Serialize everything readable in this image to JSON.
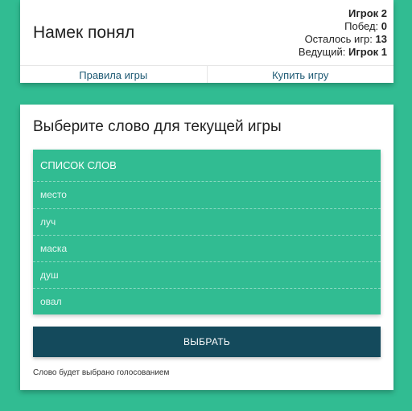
{
  "header": {
    "title": "Намек понял",
    "player": "Игрок 2",
    "wins_label": "Побед:",
    "wins_value": "0",
    "games_left_label": "Осталось игр:",
    "games_left_value": "13",
    "host_label": "Ведущий:",
    "host_value": "Игрок 1",
    "rules_link": "Правила игры",
    "buy_link": "Купить игру"
  },
  "main": {
    "title": "Выберите слово для текущей игры",
    "list_header": "Список слов",
    "words": [
      "место",
      "луч",
      "маска",
      "душ",
      "овал"
    ],
    "choose_button": "Выбрать",
    "note": "Слово будет выбрано голосованием"
  },
  "colors": {
    "background": "#31bc92",
    "button": "#144a5c",
    "link": "#1e5a74"
  }
}
